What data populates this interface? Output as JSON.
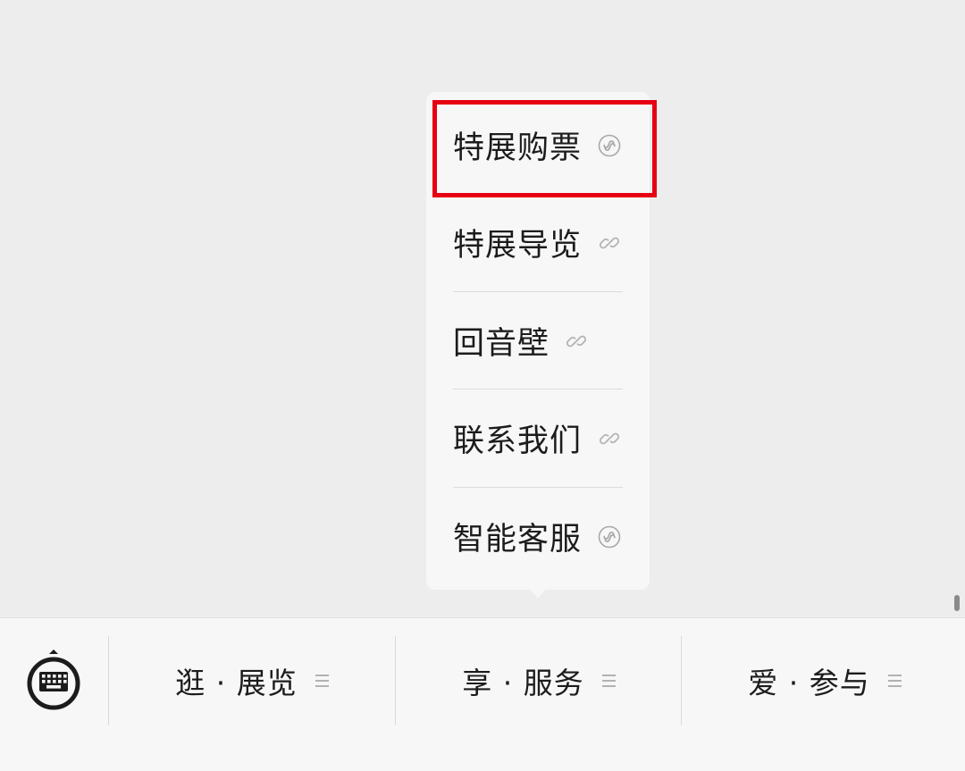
{
  "menu": {
    "items": [
      {
        "label": "特展购票",
        "icon": "mini-program-icon"
      },
      {
        "label": "特展导览",
        "icon": "link-icon"
      },
      {
        "label": "回音壁",
        "icon": "link-icon"
      },
      {
        "label": "联系我们",
        "icon": "link-icon"
      },
      {
        "label": "智能客服",
        "icon": "mini-program-icon"
      }
    ],
    "highlighted_index": 0,
    "highlight_color": "#e60012"
  },
  "bottom_bar": {
    "keyboard_button": "keyboard-toggle-icon",
    "tabs": [
      {
        "label": "逛 · 展览",
        "icon": "menu-lines-icon"
      },
      {
        "label": "享 · 服务",
        "icon": "menu-lines-icon"
      },
      {
        "label": "爱 · 参与",
        "icon": "menu-lines-icon"
      }
    ]
  }
}
